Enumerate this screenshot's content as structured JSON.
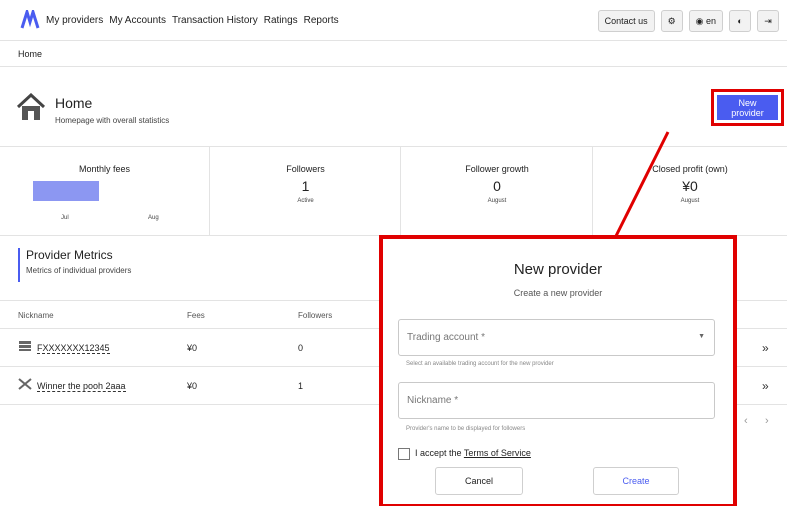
{
  "nav": {
    "items": [
      "My providers",
      "My Accounts",
      "Transaction History",
      "Ratings",
      "Reports"
    ],
    "contact_label": "Contact us",
    "language_label": "en"
  },
  "breadcrumb": "Home",
  "page": {
    "title": "Home",
    "subtitle": "Homepage with overall statistics",
    "new_provider_label": "New provider"
  },
  "stats": {
    "monthly_fees": {
      "label": "Monthly fees",
      "months": [
        "Jul",
        "Aug"
      ]
    },
    "followers": {
      "label": "Followers",
      "value": "1",
      "sub": "Active"
    },
    "follower_growth": {
      "label": "Follower growth",
      "value": "0",
      "sub": "August"
    },
    "closed_profit": {
      "label": "Closed profit (own)",
      "value": "¥0",
      "sub": "August"
    }
  },
  "metrics": {
    "title": "Provider Metrics",
    "subtitle": "Metrics of individual providers",
    "columns": [
      "Nickname",
      "Fees",
      "Followers"
    ],
    "rows": [
      {
        "nickname": "FXXXXXXX12345",
        "fees": "¥0",
        "followers": "0"
      },
      {
        "nickname": "Winner the pooh 2aaa",
        "fees": "¥0",
        "followers": "1"
      }
    ]
  },
  "dialog": {
    "title": "New provider",
    "subtitle": "Create a new provider",
    "trading_account_placeholder": "Trading account *",
    "trading_account_helper": "Select an available trading account for the new provider",
    "nickname_placeholder": "Nickname *",
    "nickname_helper": "Provider's name to be displayed for followers",
    "accept_prefix": "I accept the ",
    "terms_link": "Terms of Service",
    "cancel_label": "Cancel",
    "create_label": "Create"
  },
  "colors": {
    "accent": "#4a5cf0",
    "highlight": "#e00000",
    "bar": "#8c97f2"
  }
}
